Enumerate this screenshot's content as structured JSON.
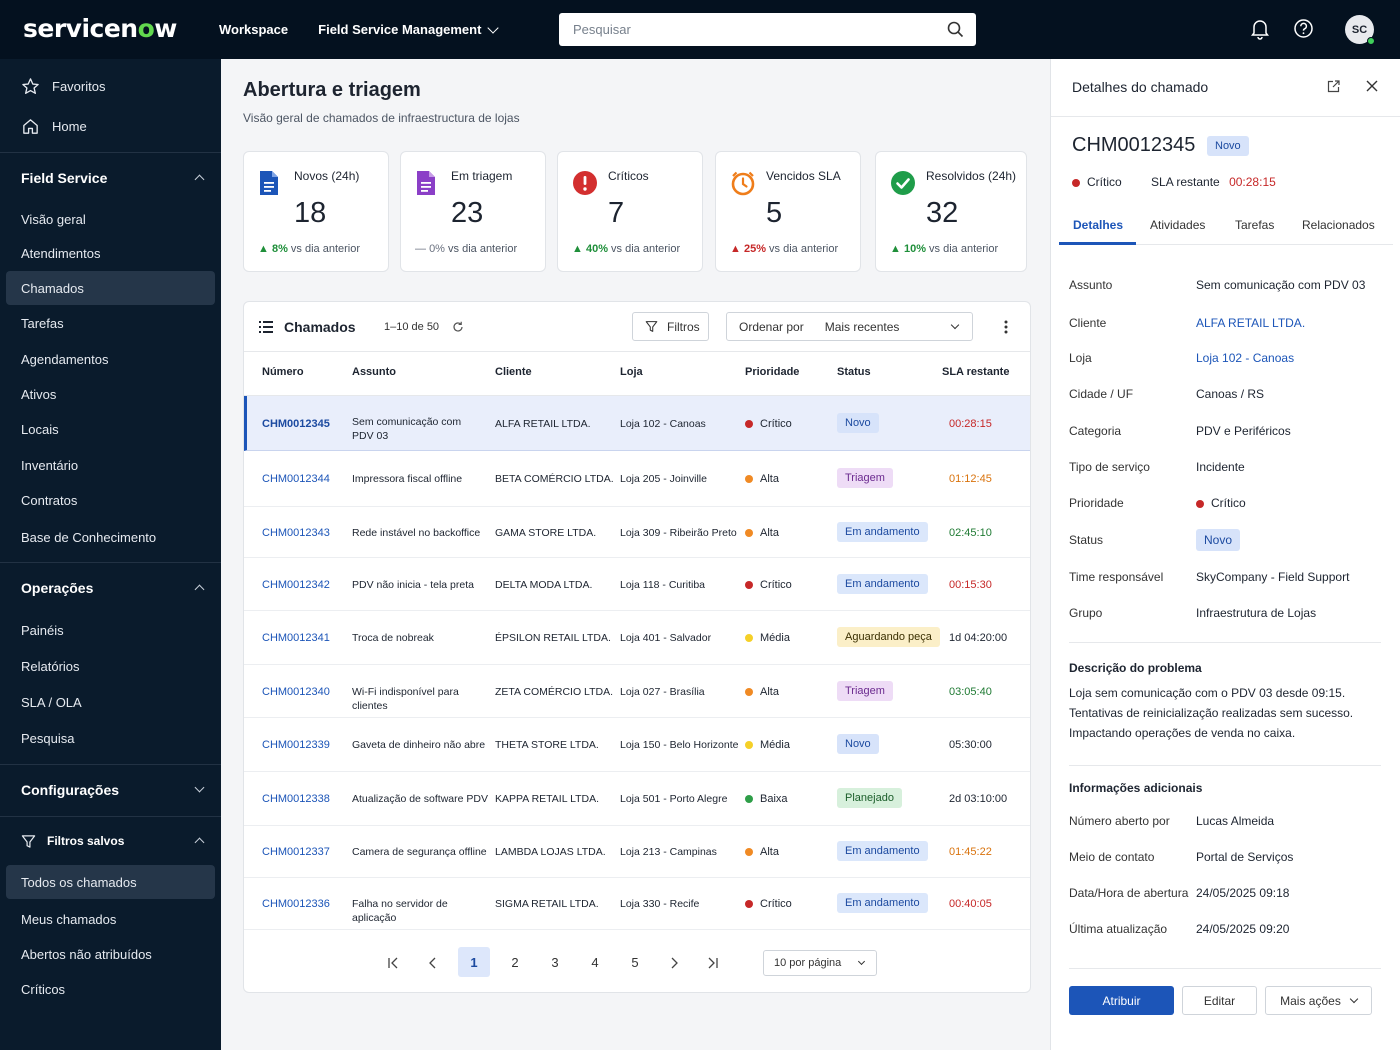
{
  "app": {
    "brand_prefix": "servicen",
    "brand_o": "o",
    "brand_suffix": "w",
    "nav": [
      "Workspace",
      "Field Service Management"
    ],
    "search_placeholder": "Pesquisar",
    "avatar_initials": "SC"
  },
  "sidebar": {
    "top": [
      "Favoritos",
      "Home"
    ],
    "field_service_title": "Field Service",
    "field_service_items": [
      "Visão geral",
      "Atendimentos",
      "Chamados",
      "Tarefas",
      "Agendamentos",
      "Ativos",
      "Locais",
      "Inventário",
      "Contratos",
      "Base de Conhecimento"
    ],
    "operacoes_title": "Operações",
    "operacoes_items": [
      "Painéis",
      "Relatórios",
      "SLA / OLA",
      "Pesquisa"
    ],
    "config_title": "Configurações",
    "filtros_title": "Filtros salvos",
    "filtros_items": [
      "Todos os chamados",
      "Meus chamados",
      "Abertos não atribuídos",
      "Críticos"
    ]
  },
  "main": {
    "title": "Abertura e triagem",
    "subtitle": "Visão geral de chamados de infraestructura de lojas",
    "kpis": [
      {
        "label": "Novos (24h)",
        "value": "18",
        "trend_pct": "8%",
        "trend_text": "vs dia anterior",
        "dir": "up",
        "color": "#1f8f3a"
      },
      {
        "label": "Em triagem",
        "value": "23",
        "trend_pct": "0%",
        "trend_text": "vs dia anterior",
        "dir": "flat",
        "color": "#6b7280"
      },
      {
        "label": "Críticos",
        "value": "7",
        "trend_pct": "40%",
        "trend_text": "vs dia anterior",
        "dir": "up",
        "color": "#1f8f3a"
      },
      {
        "label": "Vencidos SLA",
        "value": "5",
        "trend_pct": "25%",
        "trend_text": "vs dia anterior",
        "dir": "up",
        "color": "#c62828"
      },
      {
        "label": "Resolvidos (24h)",
        "value": "32",
        "trend_pct": "10%",
        "trend_text": "vs dia anterior",
        "dir": "up",
        "color": "#1f8f3a"
      }
    ],
    "table": {
      "title": "Chamados",
      "count": "1–10 de  50",
      "filters_label": "Filtros",
      "sort_label": "Ordenar por",
      "sort_value": "Mais recentes",
      "columns": [
        "Número",
        "Assunto",
        "Cliente",
        "Loja",
        "Prioridade",
        "Status",
        "SLA restante"
      ],
      "rows": [
        {
          "num": "CHM0012345",
          "assunto": "Sem comunicação com PDV 03",
          "cliente": "ALFA RETAIL LTDA.",
          "loja": "Loja 102 - Canoas",
          "prioridade": "Crítico",
          "pcolor": "#c62828",
          "status": "Novo",
          "scls": "b-novo",
          "sla": "00:28:15",
          "slacls": "sla-r"
        },
        {
          "num": "CHM0012344",
          "assunto": "Impressora fiscal offline",
          "cliente": "BETA COMÉRCIO LTDA.",
          "loja": "Loja 205 - Joinville",
          "prioridade": "Alta",
          "pcolor": "#f08a24",
          "status": "Triagem",
          "scls": "b-triagem",
          "sla": "01:12:45",
          "slacls": "sla-o"
        },
        {
          "num": "CHM0012343",
          "assunto": "Rede instável no backoffice",
          "cliente": "GAMA STORE LTDA.",
          "loja": "Loja 309 - Ribeirão Preto",
          "prioridade": "Alta",
          "pcolor": "#f08a24",
          "status": "Em andamento",
          "scls": "b-and",
          "sla": "02:45:10",
          "slacls": "sla-g"
        },
        {
          "num": "CHM0012342",
          "assunto": "PDV não inicia - tela preta",
          "cliente": "DELTA MODA LTDA.",
          "loja": "Loja 118 - Curitiba",
          "prioridade": "Crítico",
          "pcolor": "#c62828",
          "status": "Em andamento",
          "scls": "b-and",
          "sla": "00:15:30",
          "slacls": "sla-r"
        },
        {
          "num": "CHM0012341",
          "assunto": "Troca de nobreak",
          "cliente": "ÉPSILON RETAIL LTDA.",
          "loja": "Loja 401 - Salvador",
          "prioridade": "Média",
          "pcolor": "#f5d028",
          "status": "Aguardando peça",
          "scls": "b-aguard",
          "sla": "1d 04:20:00",
          "slacls": "sla-n"
        },
        {
          "num": "CHM0012340",
          "assunto": "Wi-Fi indisponível para clientes",
          "cliente": "ZETA COMÉRCIO LTDA.",
          "loja": "Loja 027 - Brasília",
          "prioridade": "Alta",
          "pcolor": "#f08a24",
          "status": "Triagem",
          "scls": "b-triagem",
          "sla": "03:05:40",
          "slacls": "sla-g"
        },
        {
          "num": "CHM0012339",
          "assunto": "Gaveta de dinheiro não abre",
          "cliente": "THETA STORE LTDA.",
          "loja": "Loja 150 - Belo Horizonte",
          "prioridade": "Média",
          "pcolor": "#f5d028",
          "status": "Novo",
          "scls": "b-novo",
          "sla": "05:30:00",
          "slacls": "sla-n"
        },
        {
          "num": "CHM0012338",
          "assunto": "Atualização de software PDV",
          "cliente": "KAPPA RETAIL LTDA.",
          "loja": "Loja 501 - Porto Alegre",
          "prioridade": "Baixa",
          "pcolor": "#2e9e48",
          "status": "Planejado",
          "scls": "b-plan",
          "sla": "2d 03:10:00",
          "slacls": "sla-n"
        },
        {
          "num": "CHM0012337",
          "assunto": "Camera de segurança offline",
          "cliente": "LAMBDA LOJAS LTDA.",
          "loja": "Loja 213 - Campinas",
          "prioridade": "Alta",
          "pcolor": "#f08a24",
          "status": "Em andamento",
          "scls": "b-and",
          "sla": "01:45:22",
          "slacls": "sla-o"
        },
        {
          "num": "CHM0012336",
          "assunto": "Falha no servidor de aplicação",
          "cliente": "SIGMA RETAIL LTDA.",
          "loja": "Loja 330 - Recife",
          "prioridade": "Crítico",
          "pcolor": "#c62828",
          "status": "Em andamento",
          "scls": "b-and",
          "sla": "00:40:05",
          "slacls": "sla-r"
        }
      ],
      "pages": [
        "1",
        "2",
        "3",
        "4",
        "5"
      ],
      "per_page": "10 por página"
    }
  },
  "panel": {
    "title": "Detalhes do chamado",
    "id": "CHM0012345",
    "status_badge": "Novo",
    "priority": "Crítico",
    "sla_label": "SLA restante",
    "sla_value": "00:28:15",
    "tabs": [
      "Detalhes",
      "Atividades",
      "Tarefas",
      "Relacionados"
    ],
    "fields": [
      {
        "k": "Assunto",
        "v": "Sem comunicação com PDV 03"
      },
      {
        "k": "Cliente",
        "v": "ALFA RETAIL LTDA.",
        "link": true
      },
      {
        "k": "Loja",
        "v": "Loja 102 - Canoas",
        "link": true
      },
      {
        "k": "Cidade / UF",
        "v": "Canoas / RS"
      },
      {
        "k": "Categoria",
        "v": "PDV e Periféricos"
      },
      {
        "k": "Tipo de serviço",
        "v": "Incidente"
      },
      {
        "k": "Prioridade",
        "v": "Crítico"
      },
      {
        "k": "Status",
        "v": "Novo"
      },
      {
        "k": "Time responsável",
        "v": "SkyCompany - Field Support"
      },
      {
        "k": "Grupo",
        "v": "Infraestrutura de Lojas"
      }
    ],
    "desc_title": "Descrição do problema",
    "desc_lines": [
      "Loja sem comunicação com o PDV 03 desde 09:15.",
      "Tentativas de reinicialização realizadas sem sucesso.",
      "Impactando operações de venda no caixa."
    ],
    "info_title": "Informações adicionais",
    "info": [
      {
        "k": "Número aberto por",
        "v": "Lucas Almeida"
      },
      {
        "k": "Meio de contato",
        "v": "Portal de Serviços"
      },
      {
        "k": "Data/Hora de abertura",
        "v": "24/05/2025  09:18"
      },
      {
        "k": "Última atualização",
        "v": "24/05/2025  09:20"
      }
    ],
    "buttons": {
      "assign": "Atribuir",
      "edit": "Editar",
      "more": "Mais ações"
    }
  },
  "colors": {
    "accent": "#1c55b8",
    "nav_bg": "#04111f",
    "sidebar_bg": "#0a1b2c",
    "critical": "#c62828"
  }
}
